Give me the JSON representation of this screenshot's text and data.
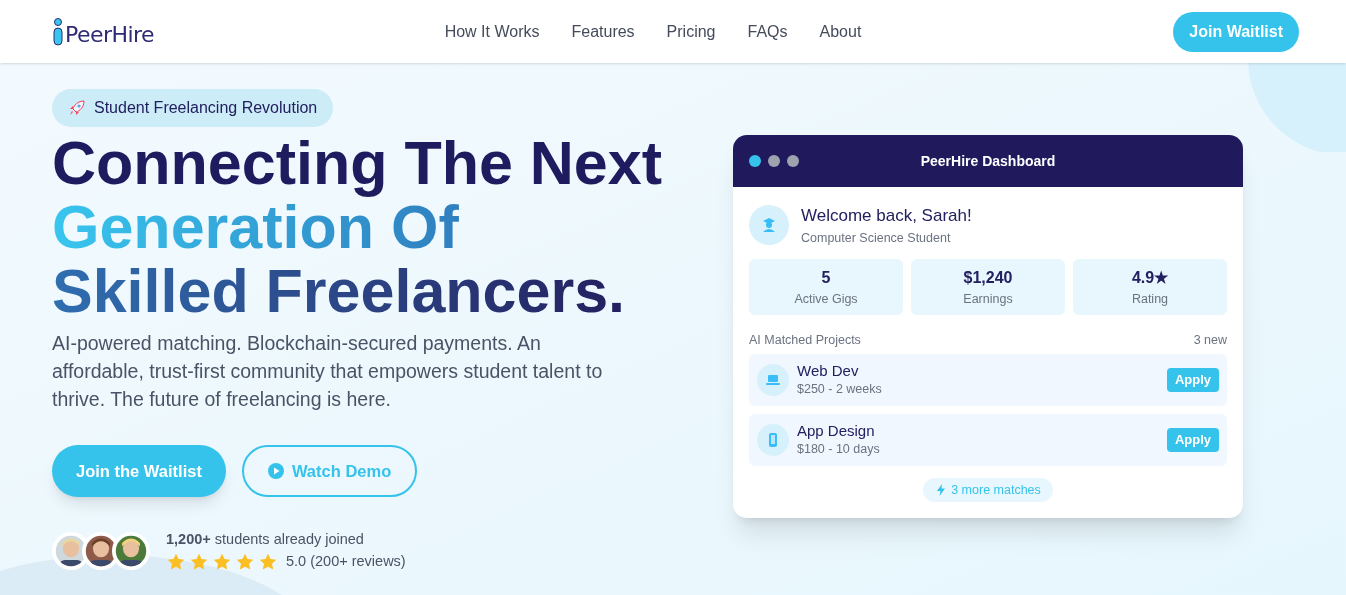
{
  "brand": "PeerHire",
  "nav": [
    "How It Works",
    "Features",
    "Pricing",
    "FAQs",
    "About"
  ],
  "nav_button": "Join Waitlist",
  "badge": "Student Freelancing Revolution",
  "headline": [
    {
      "text": "Connecting The Next",
      "kind": "dark"
    },
    {
      "text": "Generation Of",
      "kind": "cyan"
    },
    {
      "text": "Skilled Freelancers.",
      "kind": "blue"
    }
  ],
  "intro": "AI-powered matching. Blockchain-secured payments. An affordable, trust-first community that empowers student talent to thrive. The future of freelancing is here.",
  "buttons": [
    {
      "label": "Join the Waitlist",
      "kind": "primary"
    },
    {
      "label": "Watch Demo",
      "kind": "outline"
    }
  ],
  "social_proof": {
    "joined": "**1,200+** students already joined",
    "stars": 5,
    "rating": "5.0 (200+ reviews)"
  },
  "dashboard": {
    "title": "PeerHire Dashboard",
    "welcome": "Welcome back, Sarah!",
    "role": "Computer Science Student",
    "stats": [
      {
        "value": "5",
        "label": "Active Gigs"
      },
      {
        "value": "$1,240",
        "label": "Earnings"
      },
      {
        "value": "4.9★",
        "label": "Rating"
      }
    ],
    "section": "AI Matched Projects",
    "section_count": "3 new",
    "projects": [
      {
        "name": "Web Dev",
        "detail": "$250 - 2 weeks",
        "kind": "laptop",
        "action": "Apply"
      },
      {
        "name": "App Design",
        "detail": "$180 - 10 days",
        "kind": "phone",
        "action": "Apply"
      }
    ],
    "more": "3 more matches"
  }
}
